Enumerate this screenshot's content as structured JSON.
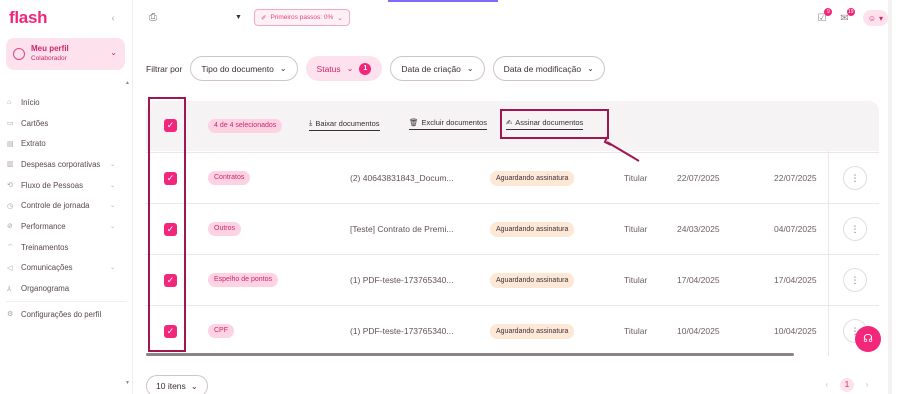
{
  "sidebar": {
    "logo": "flash",
    "profile": {
      "name": "Meu perfil",
      "role": "Colaborador"
    },
    "items": [
      {
        "label": "Início",
        "icon": "home-icon",
        "chevron": false
      },
      {
        "label": "Cartões",
        "icon": "card-icon",
        "chevron": false
      },
      {
        "label": "Extrato",
        "icon": "statement-icon",
        "chevron": false
      },
      {
        "label": "Despesas corporativas",
        "icon": "receipt-icon",
        "chevron": true
      },
      {
        "label": "Fluxo de Pessoas",
        "icon": "people-flow-icon",
        "chevron": true
      },
      {
        "label": "Controle de jornada",
        "icon": "clock-icon",
        "chevron": true
      },
      {
        "label": "Performance",
        "icon": "performance-icon",
        "chevron": true
      },
      {
        "label": "Treinamentos",
        "icon": "training-icon",
        "chevron": false
      },
      {
        "label": "Comunicações",
        "icon": "megaphone-icon",
        "chevron": true
      },
      {
        "label": "Organograma",
        "icon": "org-chart-icon",
        "chevron": false
      }
    ],
    "settings": "Configurações do perfil"
  },
  "topbar": {
    "first_steps": "Primeiros passos: 0%",
    "badge_tasks": "9",
    "badge_messages": "19"
  },
  "filters": {
    "label": "Filtrar por",
    "chips": [
      {
        "label": "Tipo do documento",
        "active": false
      },
      {
        "label": "Status",
        "active": true,
        "count": "1"
      },
      {
        "label": "Data de criação",
        "active": false
      },
      {
        "label": "Data de modificação",
        "active": false
      }
    ]
  },
  "bulk": {
    "selected": "4 de 4 selecionados",
    "download": "Baixar documentos",
    "delete": "Excluir documentos",
    "sign": "Assinar documentos"
  },
  "rows": [
    {
      "tag": "Contratos",
      "file": "(2) 40643831843_Docum...",
      "status": "Aguardando assinatura",
      "role": "Titular",
      "created": "22/07/2025",
      "modified": "22/07/2025"
    },
    {
      "tag": "Outros",
      "file": "[Teste] Contrato de Premi...",
      "status": "Aguardando assinatura",
      "role": "Titular",
      "created": "24/03/2025",
      "modified": "04/07/2025"
    },
    {
      "tag": "Espelho de pontos",
      "file": "(1) PDF-teste-173765340...",
      "status": "Aguardando assinatura",
      "role": "Titular",
      "created": "17/04/2025",
      "modified": "17/04/2025"
    },
    {
      "tag": "CPF",
      "file": "(1) PDF-teste-173765340...",
      "status": "Aguardando assinatura",
      "role": "Titular",
      "created": "10/04/2025",
      "modified": "10/04/2025"
    }
  ],
  "footer": {
    "page_size": "10 itens",
    "current_page": "1"
  },
  "colors": {
    "brand": "#f2267a",
    "annotation": "#a01650"
  }
}
